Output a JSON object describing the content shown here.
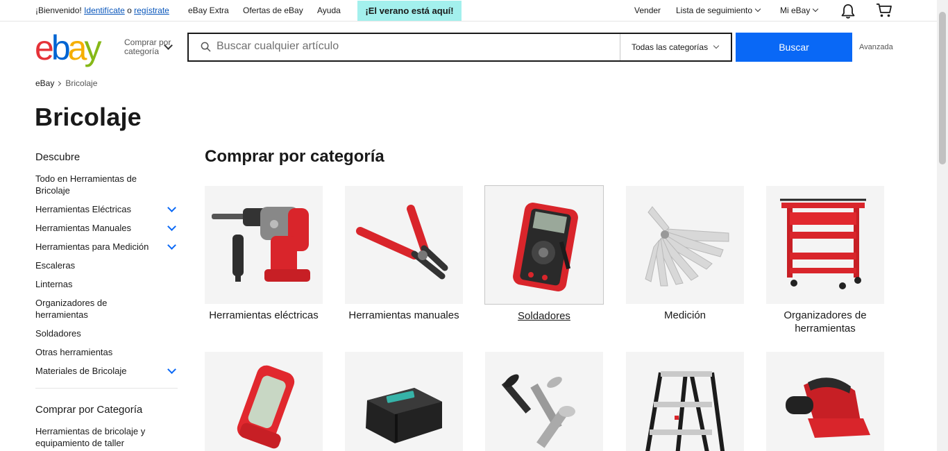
{
  "topbar": {
    "welcome": "¡Bienvenido!",
    "signin": "Identifícate",
    "or": "o",
    "register": "regístrate",
    "ebay_extra": "eBay Extra",
    "deals": "Ofertas de eBay",
    "help": "Ayuda",
    "promo": "¡El verano está aquí!",
    "sell": "Vender",
    "watchlist": "Lista de seguimiento",
    "my_ebay": "Mi eBay"
  },
  "header": {
    "logo_letters": [
      "e",
      "b",
      "a",
      "y"
    ],
    "logo_colors": [
      "#e53238",
      "#0064d2",
      "#f5af02",
      "#86b817"
    ],
    "shop_by_category": "Comprar por categoría",
    "search_placeholder": "Buscar cualquier artículo",
    "category_select": "Todas las categorías",
    "search_button": "Buscar",
    "advanced": "Avanzada",
    "accent": "#0968f6"
  },
  "breadcrumb": {
    "home": "eBay",
    "current": "Bricolaje"
  },
  "page_title": "Bricolaje",
  "sidebar": {
    "discover_heading": "Descubre",
    "items": [
      {
        "label": "Todo en Herramientas de Bricolaje",
        "expandable": false
      },
      {
        "label": "Herramientas Eléctricas",
        "expandable": true
      },
      {
        "label": "Herramientas Manuales",
        "expandable": true
      },
      {
        "label": "Herramientas para Medición",
        "expandable": true
      },
      {
        "label": "Escaleras",
        "expandable": false
      },
      {
        "label": "Linternas",
        "expandable": false
      },
      {
        "label": "Organizadores de herramientas",
        "expandable": false
      },
      {
        "label": "Soldadores",
        "expandable": false
      },
      {
        "label": "Otras herramientas",
        "expandable": false
      },
      {
        "label": "Materiales de Bricolaje",
        "expandable": true
      }
    ],
    "category_heading": "Comprar por Categoría",
    "category_items": [
      "Herramientas de bricolaje y equipamiento de taller"
    ]
  },
  "main": {
    "heading": "Comprar por categoría",
    "tiles": [
      {
        "label": "Herramientas eléctricas",
        "icon": "rotary-hammer-icon"
      },
      {
        "label": "Herramientas manuales",
        "icon": "pliers-icon"
      },
      {
        "label": "Soldadores",
        "icon": "multimeter-icon",
        "hovered": true
      },
      {
        "label": "Medición",
        "icon": "feeler-gauge-icon"
      },
      {
        "label": "Organizadores de herramientas",
        "icon": "tool-cart-icon"
      },
      {
        "label": "",
        "icon": "work-light-icon"
      },
      {
        "label": "",
        "icon": "battery-pack-icon"
      },
      {
        "label": "",
        "icon": "screws-icon"
      },
      {
        "label": "",
        "icon": "step-ladder-icon"
      },
      {
        "label": "",
        "icon": "orbital-sander-icon"
      }
    ]
  }
}
